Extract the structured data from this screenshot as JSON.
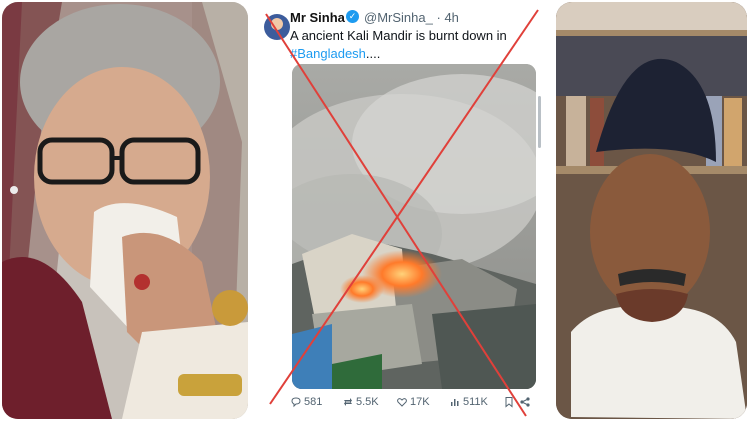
{
  "tweet": {
    "display_name": "Mr Sinha",
    "handle": "@MrSinha_",
    "separator": "·",
    "time": "4h",
    "text_line1": "A ancient Kali Mandir is burnt down in",
    "hashtag": "#Bangladesh",
    "ellipsis": "....",
    "actions": {
      "replies": "581",
      "retweets": "5.5K",
      "likes": "17K",
      "views": "511K"
    }
  },
  "colors": {
    "accent": "#1d9bf0",
    "cross": "#e0403a",
    "muted_text": "#536471"
  },
  "icons": [
    "verified-badge-icon",
    "reply-icon",
    "retweet-icon",
    "like-icon",
    "views-icon",
    "bookmark-icon",
    "share-icon"
  ]
}
